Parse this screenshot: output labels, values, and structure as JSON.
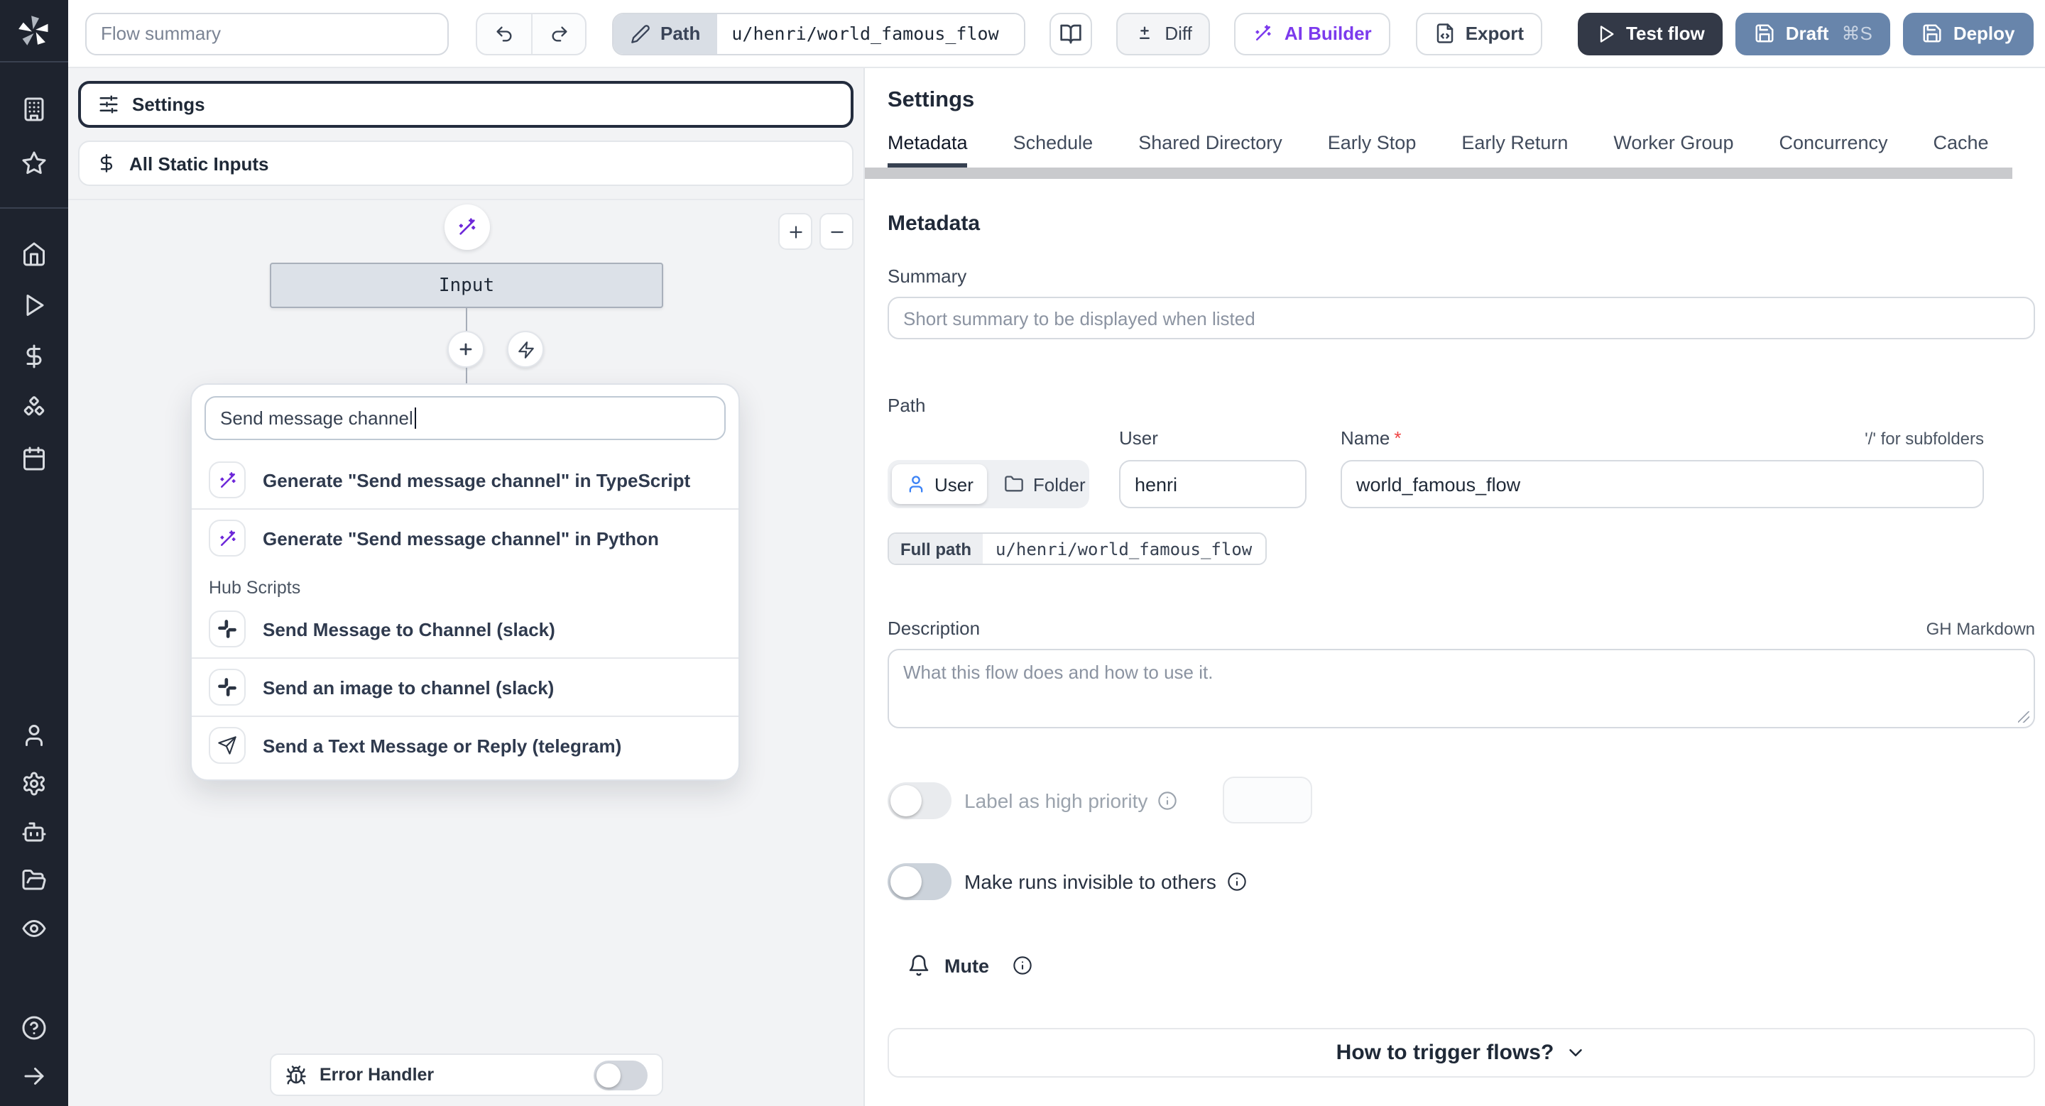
{
  "topbar": {
    "flow_summary_placeholder": "Flow summary",
    "path_chip_label": "Path",
    "path_value": "u/henri/world_famous_flow",
    "diff_label": "Diff",
    "ai_builder_label": "AI Builder",
    "export_label": "Export",
    "test_flow_label": "Test flow",
    "draft_label": "Draft",
    "draft_shortcut": "⌘S",
    "deploy_label": "Deploy"
  },
  "sidebar": {
    "icons": [
      "windmill-logo",
      "building",
      "star",
      "home",
      "play",
      "dollar",
      "boxes",
      "calendar",
      "user",
      "settings-gear",
      "robot",
      "folder-open",
      "eye",
      "help",
      "expand-arrow"
    ]
  },
  "flow_panel": {
    "settings_label": "Settings",
    "all_static_inputs_label": "All Static Inputs",
    "input_node_label": "Input",
    "search_value": "Send message channel",
    "generate_results": [
      {
        "label": "Generate \"Send message channel\" in TypeScript"
      },
      {
        "label": "Generate \"Send message channel\" in Python"
      }
    ],
    "hub_section_label": "Hub Scripts",
    "hub_results": [
      {
        "label": "Send Message to Channel (slack)",
        "integration": "slack"
      },
      {
        "label": "Send an image to channel (slack)",
        "integration": "slack"
      },
      {
        "label": "Send a Text Message or Reply (telegram)",
        "integration": "telegram"
      }
    ],
    "error_handler_label": "Error Handler"
  },
  "settings_panel": {
    "title": "Settings",
    "tabs": [
      "Metadata",
      "Schedule",
      "Shared Directory",
      "Early Stop",
      "Early Return",
      "Worker Group",
      "Concurrency",
      "Cache"
    ],
    "active_tab": "Metadata",
    "metadata": {
      "heading": "Metadata",
      "summary_label": "Summary",
      "summary_placeholder": "Short summary to be displayed when listed",
      "path_label": "Path",
      "owner_toggle_user": "User",
      "owner_toggle_folder": "Folder",
      "user_field_label": "User",
      "user_field_value": "henri",
      "name_field_label": "Name",
      "required_mark": "*",
      "name_field_value": "world_famous_flow",
      "subfolder_hint": "'/' for subfolders",
      "full_path_label": "Full path",
      "full_path_value": "u/henri/world_famous_flow",
      "description_label": "Description",
      "markdown_hint": "GH Markdown",
      "description_placeholder": "What this flow does and how to use it.",
      "high_priority_label": "Label as high priority",
      "invisible_runs_label": "Make runs invisible to others",
      "mute_label": "Mute",
      "trigger_help_label": "How to trigger flows?"
    }
  },
  "colors": {
    "accent_purple": "#7c3aed",
    "action_dark": "#333947",
    "action_blue": "#6885ab",
    "link_blue": "#3b82f6",
    "sidebar_bg": "#1e232e"
  }
}
